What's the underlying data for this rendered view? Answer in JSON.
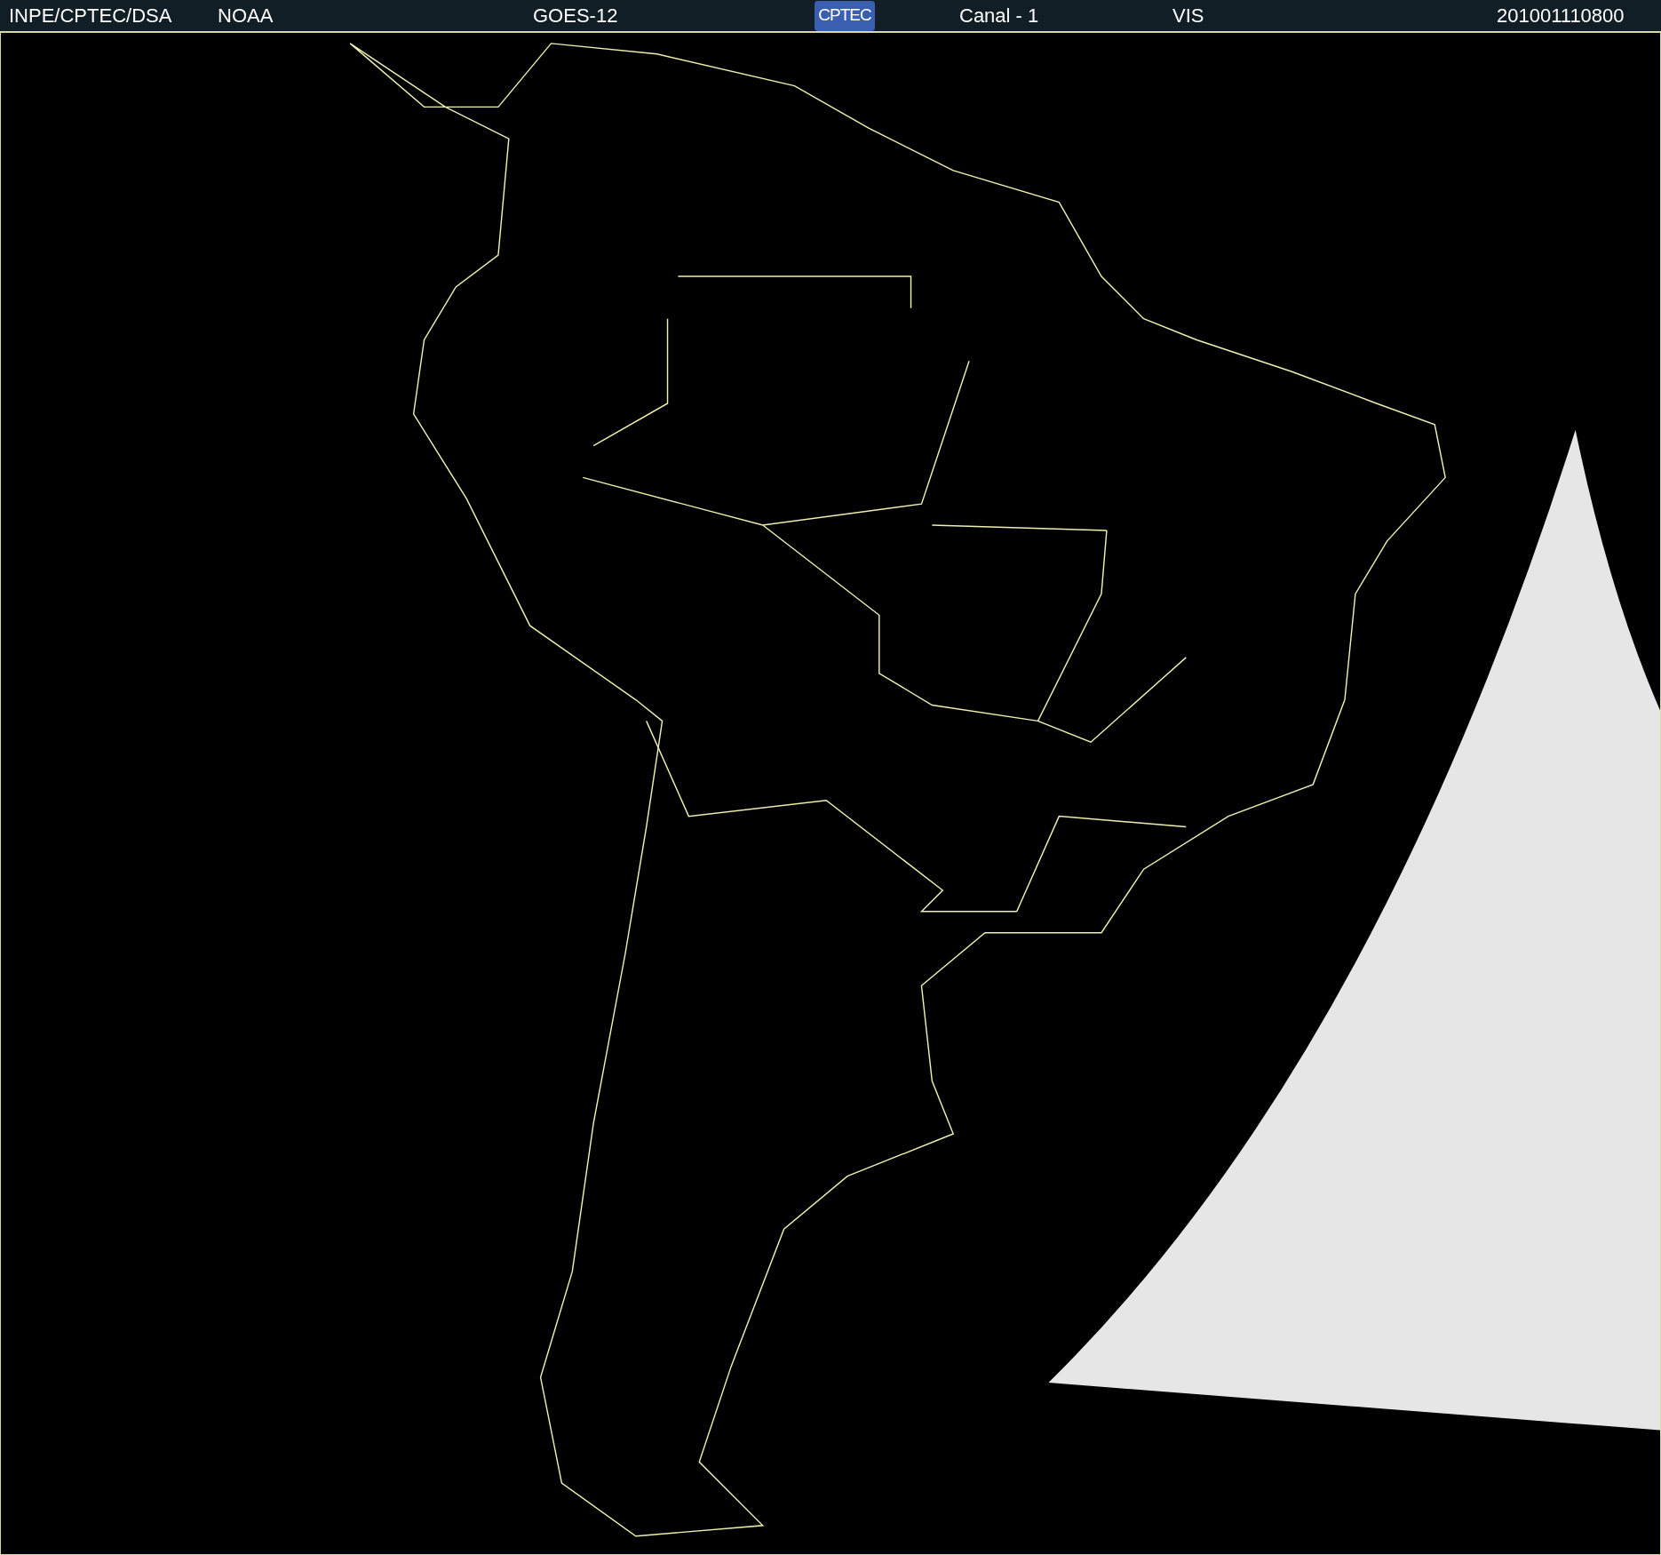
{
  "header": {
    "source": "INPE/CPTEC/DSA",
    "agency": "NOAA",
    "satellite": "GOES-12",
    "logo_text": "CPTEC",
    "channel": "Canal - 1",
    "band": "VIS",
    "timestamp": "201001110800"
  }
}
